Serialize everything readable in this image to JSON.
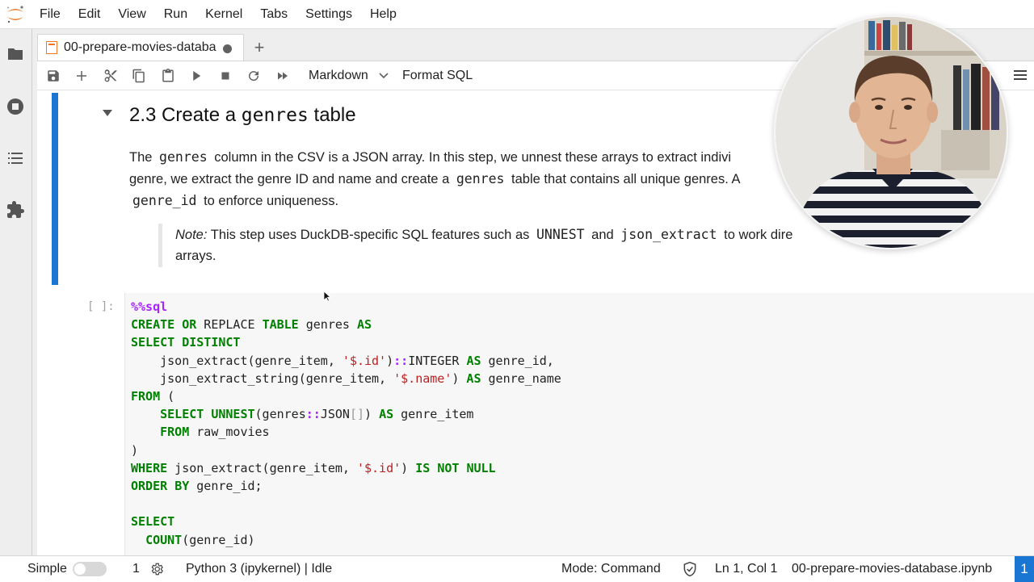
{
  "menubar": {
    "items": [
      "File",
      "Edit",
      "View",
      "Run",
      "Kernel",
      "Tabs",
      "Settings",
      "Help"
    ]
  },
  "leftbar": {
    "icons": [
      "folder-icon",
      "stop-circle-icon",
      "list-icon",
      "puzzle-icon"
    ]
  },
  "tabs": {
    "document_title": "00-prepare-movies-databa",
    "new_tab_label": "+"
  },
  "toolbar": {
    "cell_type": "Markdown",
    "format_sql": "Format SQL"
  },
  "markdown_cell": {
    "heading_prefix": "2.3 Create a",
    "heading_code": "genres",
    "heading_suffix": "table",
    "para_line1_a": "The",
    "para_line1_code": "genres",
    "para_line1_b": "column in the CSV is a JSON array. In this step, we unnest these arrays to extract indivi",
    "para_line2_a": "genre, we extract the genre ID and name and create a",
    "para_line2_code": "genres",
    "para_line2_b": "table that contains all unique genres. A",
    "para_line3_code": "genre_id",
    "para_line3_b": "to enforce uniqueness.",
    "note_label": "Note:",
    "note_a": "This step uses DuckDB-specific SQL features such as",
    "note_code1": "UNNEST",
    "note_and": "and",
    "note_code2": "json_extract",
    "note_b": "to work dire",
    "note_line2": "arrays."
  },
  "code_cell": {
    "prompt": "[ ]:",
    "lines": [
      "%%sql",
      "CREATE OR REPLACE TABLE genres AS",
      "SELECT DISTINCT",
      "    json_extract(genre_item, '$.id')::INTEGER AS genre_id,",
      "    json_extract_string(genre_item, '$.name') AS genre_name",
      "FROM (",
      "    SELECT UNNEST(genres::JSON[]) AS genre_item",
      "    FROM raw_movies",
      ")",
      "WHERE json_extract(genre_item, '$.id') IS NOT NULL",
      "ORDER BY genre_id;",
      "",
      "SELECT",
      "  COUNT(genre_id)"
    ]
  },
  "statusbar": {
    "mode_simple": "Simple",
    "terminals_count": "1",
    "kernel_status": "Python 3 (ipykernel) | Idle",
    "mode": "Mode: Command",
    "cursor_pos": "Ln 1, Col 1",
    "filename": "00-prepare-movies-database.ipynb",
    "badge": "1"
  },
  "colors": {
    "accent": "#1976d2",
    "keyword": "#008000",
    "string": "#ba2121",
    "magic": "#aa22ff"
  }
}
